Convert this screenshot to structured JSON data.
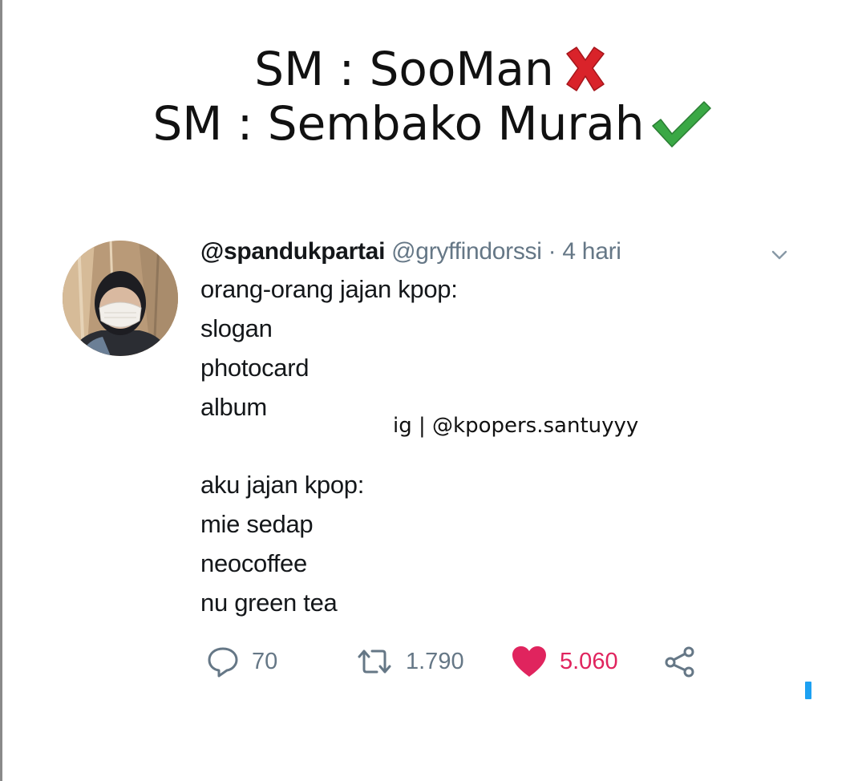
{
  "meme": {
    "line1": "SM : SooMan",
    "line1_mark": "cross-mark",
    "line2": "SM : Sembako Murah",
    "line2_mark": "check-mark"
  },
  "tweet": {
    "display_name": "@spandukpartai",
    "handle": "@gryffindorssi",
    "separator": "·",
    "time": "4 hari",
    "lines_part1": [
      "orang-orang jajan kpop:",
      "slogan",
      "photocard",
      "album"
    ],
    "lines_part2": [
      "aku jajan kpop:",
      "mie sedap",
      "neocoffee",
      "nu green tea"
    ],
    "actions": {
      "replies": "70",
      "retweets": "1.790",
      "likes": "5.060"
    }
  },
  "watermark": "ig | @kpopers.santuyyy",
  "colors": {
    "like": "#e0245e",
    "muted": "#657786",
    "accent": "#1da1f2",
    "cross": "#d9232a",
    "check": "#3aa845"
  },
  "icons": {
    "reply": "reply-icon",
    "retweet": "retweet-icon",
    "like": "heart-icon",
    "share": "share-icon",
    "caret": "chevron-down-icon"
  }
}
